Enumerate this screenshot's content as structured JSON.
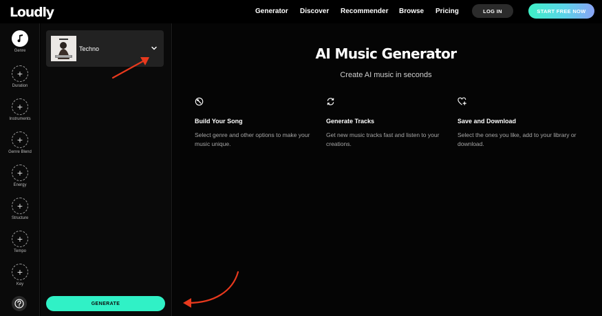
{
  "header": {
    "logo": "Loudly",
    "nav": [
      "Generator",
      "Discover",
      "Recommender",
      "Browse",
      "Pricing"
    ],
    "login": "LOG IN",
    "start": "START FREE NOW"
  },
  "rail": {
    "items": [
      {
        "label": "Genre",
        "icon": "music-note-icon",
        "active": true
      },
      {
        "label": "Duration",
        "icon": "plus-icon"
      },
      {
        "label": "Instruments",
        "icon": "plus-icon"
      },
      {
        "label": "Genre Blend",
        "icon": "plus-icon"
      },
      {
        "label": "Energy",
        "icon": "plus-icon"
      },
      {
        "label": "Structure",
        "icon": "plus-icon"
      },
      {
        "label": "Tempo",
        "icon": "plus-icon"
      },
      {
        "label": "Key",
        "icon": "plus-icon"
      }
    ],
    "help_icon": "question-icon"
  },
  "panel": {
    "genre": "Techno",
    "generate": "GENERATE"
  },
  "main": {
    "title": "AI Music Generator",
    "subtitle": "Create AI music in seconds",
    "features": [
      {
        "title": "Build Your Song",
        "desc": "Select genre and other options to make your music unique.",
        "icon": "wrench-icon"
      },
      {
        "title": "Generate Tracks",
        "desc": "Get new music tracks fast and listen to your creations.",
        "icon": "refresh-icon"
      },
      {
        "title": "Save and Download",
        "desc": "Select the ones you like, add to your library or download.",
        "icon": "heart-plus-icon"
      }
    ]
  },
  "colors": {
    "accent": "#30f1c6",
    "annotation_arrow": "#e8391d"
  }
}
